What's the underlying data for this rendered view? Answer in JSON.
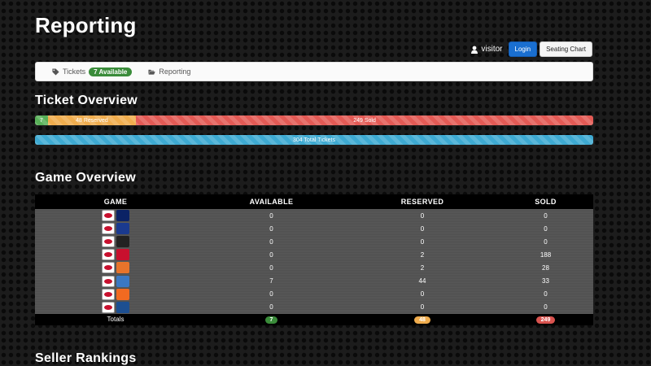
{
  "header": {
    "title": "Reporting"
  },
  "userbar": {
    "username": "visitor",
    "login_label": "Login",
    "seating_label": "Seating Chart"
  },
  "nav": {
    "tickets_label": "Tickets",
    "tickets_badge": "7 Available",
    "reporting_label": "Reporting"
  },
  "ticket_overview": {
    "title": "Ticket Overview",
    "available_label": "7",
    "available_fraction": 0.023,
    "reserved_label": "48 Reserved",
    "reserved_fraction": 0.158,
    "sold_label": "249 Sold",
    "sold_fraction": 0.819,
    "total_label": "304 Total Tickets"
  },
  "game_overview": {
    "title": "Game Overview",
    "headers": [
      "GAME",
      "AVAILABLE",
      "RESERVED",
      "SOLD"
    ],
    "rows": [
      {
        "opponent": "dallas-cowboys-icon",
        "opp_color": "#0b2265",
        "available": "0",
        "reserved": "0",
        "sold": "0"
      },
      {
        "opponent": "new-york-giants-icon",
        "opp_color": "#1a3a8f",
        "available": "0",
        "reserved": "0",
        "sold": "0"
      },
      {
        "opponent": "oakland-raiders-icon",
        "opp_color": "#222222",
        "available": "0",
        "reserved": "0",
        "sold": "0"
      },
      {
        "opponent": "houston-texans-icon",
        "opp_color": "#c8102e",
        "available": "0",
        "reserved": "2",
        "sold": "188"
      },
      {
        "opponent": "cleveland-browns-icon",
        "opp_color": "#e8742b",
        "available": "0",
        "reserved": "2",
        "sold": "28"
      },
      {
        "opponent": "san-diego-chargers-icon",
        "opp_color": "#3b78c3",
        "available": "7",
        "reserved": "44",
        "sold": "33"
      },
      {
        "opponent": "denver-broncos-icon",
        "opp_color": "#f26a21",
        "available": "0",
        "reserved": "0",
        "sold": "0"
      },
      {
        "opponent": "indianapolis-colts-icon",
        "opp_color": "#1d4f91",
        "available": "0",
        "reserved": "0",
        "sold": "0"
      }
    ],
    "totals": {
      "label": "Totals",
      "available": "7",
      "reserved": "48",
      "sold": "249"
    }
  },
  "seller_rankings": {
    "title": "Seller Rankings"
  },
  "colors": {
    "available": "#58b058",
    "reserved": "#f0ad4e",
    "sold": "#e35a55",
    "total": "#3eaad2"
  }
}
